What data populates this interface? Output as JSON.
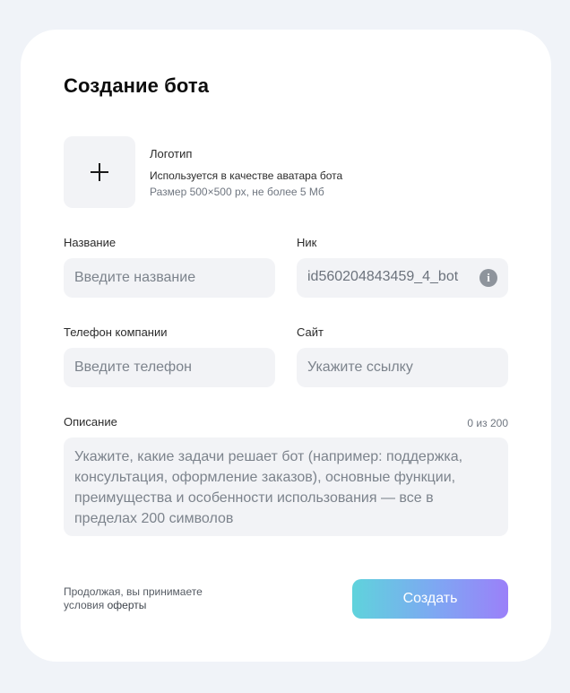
{
  "form": {
    "title": "Создание бота",
    "logo": {
      "title": "Логотип",
      "description": "Используется в качестве аватара бота",
      "size_hint": "Размер 500×500 px, не более 5 Мб",
      "icon": "plus-icon"
    },
    "name": {
      "label": "Название",
      "placeholder": "Введите название",
      "value": ""
    },
    "nick": {
      "label": "Ник",
      "value": "id560204843459_4_bot",
      "icon": "info-icon",
      "icon_glyph": "i"
    },
    "phone": {
      "label": "Телефон компании",
      "placeholder": "Введите телефон",
      "value": ""
    },
    "site": {
      "label": "Сайт",
      "placeholder": "Укажите ссылку",
      "value": ""
    },
    "description": {
      "label": "Описание",
      "counter": "0 из 200",
      "placeholder": "Укажите, какие задачи решает бот (например: поддержка, консультация, оформление заказов), основные функции, преимущества и особенности использования — все в пределах 200 символов",
      "value": ""
    },
    "terms": {
      "prefix": "Продолжая, вы принимаете",
      "link_prefix": "условия ",
      "link": "оферты"
    },
    "submit_label": "Создать"
  },
  "colors": {
    "page_background": "#f0f3f8",
    "card_background": "#ffffff",
    "field_background": "#f2f3f6",
    "button_gradient_start": "#5fd3dc",
    "button_gradient_end": "#9b80f9"
  }
}
